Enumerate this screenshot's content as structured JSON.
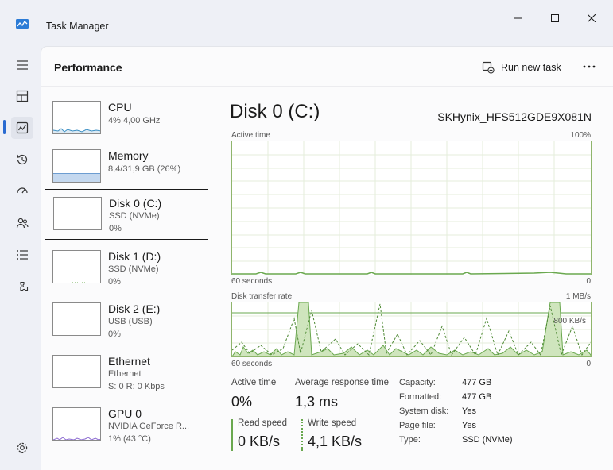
{
  "window": {
    "title": "Task Manager"
  },
  "header": {
    "title": "Performance",
    "run_new_task": "Run new task"
  },
  "sidebar": [
    {
      "name": "CPU",
      "line1": "4% 4,00 GHz",
      "line2": ""
    },
    {
      "name": "Memory",
      "line1": "8,4/31,9 GB (26%)",
      "line2": ""
    },
    {
      "name": "Disk 0 (C:)",
      "line1": "SSD (NVMe)",
      "line2": "0%"
    },
    {
      "name": "Disk 1 (D:)",
      "line1": "SSD (NVMe)",
      "line2": "0%"
    },
    {
      "name": "Disk 2 (E:)",
      "line1": "USB (USB)",
      "line2": "0%"
    },
    {
      "name": "Ethernet",
      "line1": "Ethernet",
      "line2": "S: 0 R: 0 Kbps"
    },
    {
      "name": "GPU 0",
      "line1": "NVIDIA GeForce R...",
      "line2": "1% (43 °C)"
    }
  ],
  "detail": {
    "title": "Disk 0 (C:)",
    "model": "SKHynix_HFS512GDE9X081N",
    "active_time_graph": {
      "label": "Active time",
      "max": "100%",
      "left": "60 seconds",
      "right": "0"
    },
    "transfer_graph": {
      "label": "Disk transfer rate",
      "max": "1 MB/s",
      "mid": "800 KB/s",
      "left": "60 seconds",
      "right": "0"
    },
    "active_time": {
      "label": "Active time",
      "value": "0%"
    },
    "avg_response": {
      "label": "Average response time",
      "value": "1,3 ms"
    },
    "read_speed": {
      "label": "Read speed",
      "value": "0 KB/s"
    },
    "write_speed": {
      "label": "Write speed",
      "value": "4,1 KB/s"
    },
    "props": [
      {
        "k": "Capacity:",
        "v": "477 GB"
      },
      {
        "k": "Formatted:",
        "v": "477 GB"
      },
      {
        "k": "System disk:",
        "v": "Yes"
      },
      {
        "k": "Page file:",
        "v": "Yes"
      },
      {
        "k": "Type:",
        "v": "SSD (NVMe)"
      }
    ]
  },
  "colors": {
    "disk_green": "#6aa84f",
    "accent": "#2a6bd1",
    "cpu_blue": "#3b8fc4",
    "gpu_purple": "#8c6bd1"
  },
  "icons": [
    "task-manager-app-icon",
    "minimize-icon",
    "maximize-icon",
    "close-icon",
    "hamburger-menu-icon",
    "processes-icon",
    "performance-icon",
    "app-history-icon",
    "startup-apps-icon",
    "users-icon",
    "details-icon",
    "services-icon",
    "settings-icon",
    "run-new-task-icon",
    "more-options-icon"
  ]
}
